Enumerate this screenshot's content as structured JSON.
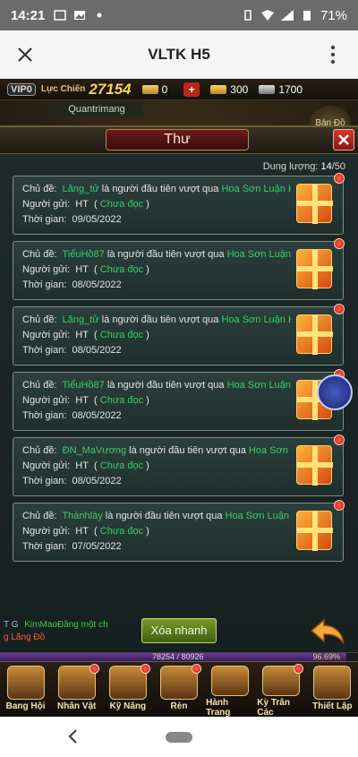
{
  "status_bar": {
    "time": "14:21",
    "battery": "71%"
  },
  "browser": {
    "title": "VLTK H5"
  },
  "game_top": {
    "vip": "VIP0",
    "power_label": "Lực Chiến",
    "power_value": "27154",
    "gold": "0",
    "ingot": "300",
    "silver": "1700"
  },
  "background": {
    "name_tag": "Quantrimang",
    "map_btn": "Bản Đồ"
  },
  "panel": {
    "title": "Thư",
    "capacity_label": "Dung lượng:",
    "capacity_value": "14",
    "capacity_max": "/50",
    "quick_delete": "Xóa nhanh"
  },
  "mail_labels": {
    "subject": "Chủ đề:",
    "sender": "Người gửi:",
    "time": "Thời gian:",
    "first_pass": "là người đầu tiên vượt qua",
    "unread": "Chưa đọc"
  },
  "mails": [
    {
      "player": "Lăng_tử",
      "dungeon": "Hoa Sơn Luận Kiế",
      "sender": "HT",
      "date": "09/05/2022"
    },
    {
      "player": "TiểuHồ87",
      "dungeon": "Hoa Sơn Luận Ki",
      "sender": "HT",
      "date": "08/05/2022"
    },
    {
      "player": "Lăng_tử",
      "dungeon": "Hoa Sơn Luận Kiế",
      "sender": "HT",
      "date": "08/05/2022"
    },
    {
      "player": "TiểuHồ87",
      "dungeon": "Hoa Sơn Luận Ki",
      "sender": "HT",
      "date": "08/05/2022"
    },
    {
      "player": "ĐN_MaVương",
      "dungeon": "Hoa Sơn Luậ",
      "sender": "HT",
      "date": "08/05/2022"
    },
    {
      "player": "Thánhlày",
      "dungeon": "Hoa Sơn Luận Kiế",
      "sender": "HT",
      "date": "07/05/2022"
    }
  ],
  "chat": {
    "tag": "T G",
    "line1": "KimMaoĐăng một ch",
    "line2": "g Lăng Đồ"
  },
  "exp": {
    "text": "78254 / 80926",
    "percent": "96.69%",
    "fraction": 0.9669
  },
  "bottom_menu": [
    {
      "label": "Bang Hội",
      "dot": false
    },
    {
      "label": "Nhân Vật",
      "dot": true
    },
    {
      "label": "Kỹ Năng",
      "dot": true
    },
    {
      "label": "Rèn",
      "dot": true
    },
    {
      "label": "Hành Trang",
      "dot": false
    },
    {
      "label": "Kỳ Trân Các",
      "dot": true
    },
    {
      "label": "Thiết Lập",
      "dot": false
    }
  ]
}
